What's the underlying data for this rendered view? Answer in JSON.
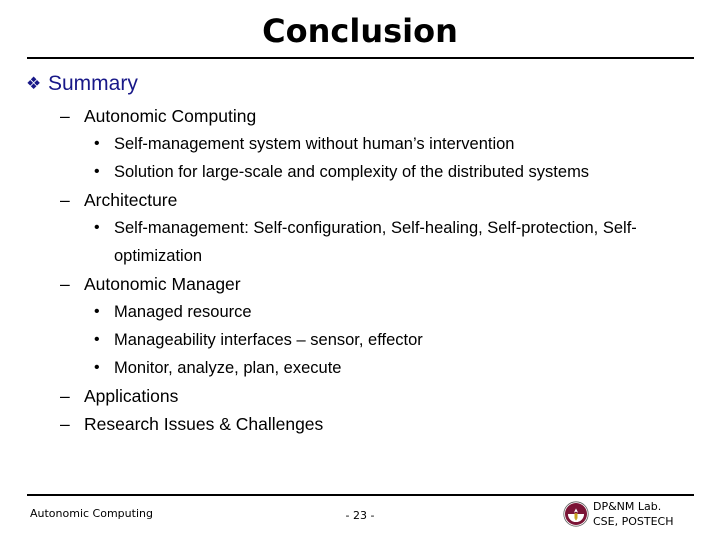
{
  "slide": {
    "title": "Conclusion",
    "page_number": "- 23 -"
  },
  "outline": {
    "heading": {
      "bullet": "❖",
      "text": "Summary",
      "color": "#181888"
    },
    "items": [
      {
        "level": 2,
        "bullet": "–",
        "text": "Autonomic Computing"
      },
      {
        "level": 3,
        "bullet": "•",
        "text": "Self-management system without human’s intervention"
      },
      {
        "level": 3,
        "bullet": "•",
        "text": "Solution for large-scale and complexity of the distributed systems"
      },
      {
        "level": 2,
        "bullet": "–",
        "text": "Architecture"
      },
      {
        "level": 3,
        "bullet": "•",
        "text": "Self-management: Self-configuration, Self-healing, Self-protection, Self-optimization"
      },
      {
        "level": 2,
        "bullet": "–",
        "text": "Autonomic Manager"
      },
      {
        "level": 3,
        "bullet": "•",
        "text": "Managed resource"
      },
      {
        "level": 3,
        "bullet": "•",
        "text": "Manageability interfaces – sensor, effector"
      },
      {
        "level": 3,
        "bullet": "•",
        "text": "Monitor, analyze, plan, execute"
      },
      {
        "level": 2,
        "bullet": "–",
        "text": "Applications"
      },
      {
        "level": 2,
        "bullet": "–",
        "text": "Research Issues & Challenges"
      }
    ]
  },
  "footer": {
    "left_text": "Autonomic Computing",
    "lab_line1": "DP&NM Lab.",
    "lab_line2": "CSE, POSTECH",
    "logo_name": "postech-seal-icon",
    "logo_color": "#7b1436"
  }
}
